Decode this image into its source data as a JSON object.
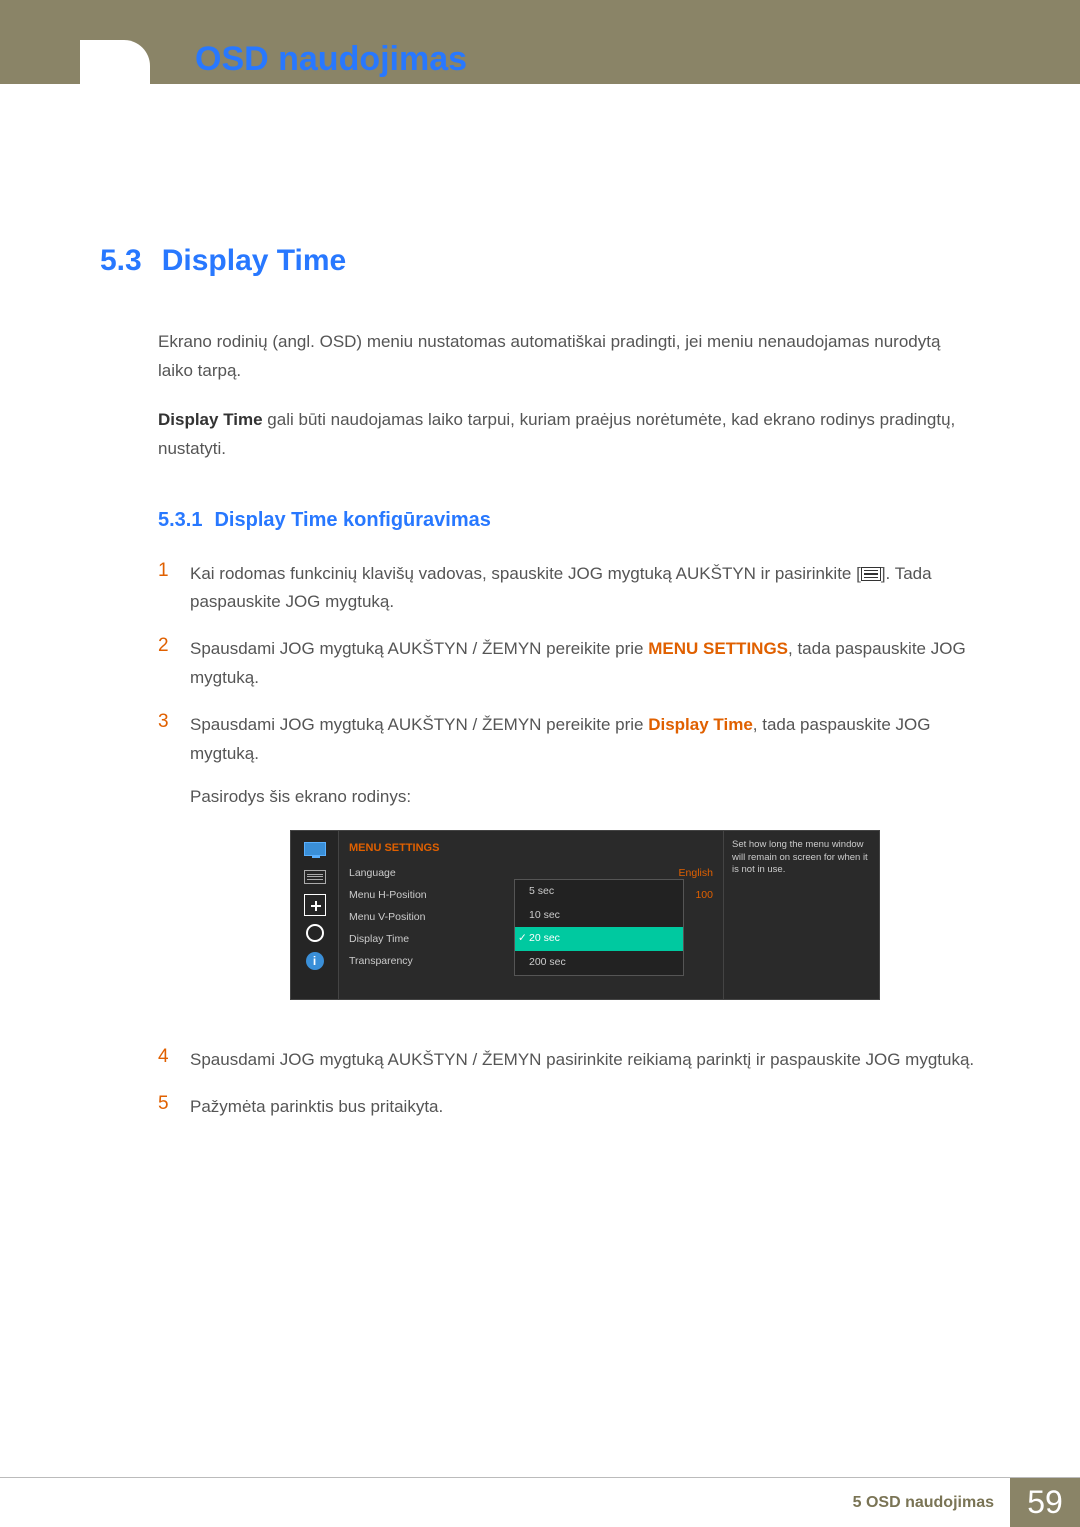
{
  "header": {
    "chapter_title": "OSD naudojimas"
  },
  "section": {
    "number": "5.3",
    "title": "Display Time",
    "para1": "Ekrano rodinių (angl. OSD) meniu nustatomas automatiškai pradingti, jei meniu nenaudojamas nurodytą laiko tarpą.",
    "para2_bold": "Display Time",
    "para2_rest": " gali būti naudojamas laiko tarpui, kuriam praėjus norėtumėte, kad ekrano rodinys pradingtų, nustatyti."
  },
  "subsection": {
    "number": "5.3.1",
    "title": "Display Time konfigūravimas"
  },
  "steps": [
    {
      "n": "1",
      "before": "Kai rodomas funkcinių klavišų vadovas, spauskite JOG mygtuką AUKŠTYN ir pasirinkite [",
      "after": "]. Tada paspauskite JOG mygtuką."
    },
    {
      "n": "2",
      "before": "Spausdami JOG mygtuką AUKŠTYN / ŽEMYN pereikite prie ",
      "orange": "MENU SETTINGS",
      "after": ", tada paspauskite JOG mygtuką."
    },
    {
      "n": "3",
      "before": "Spausdami JOG mygtuką AUKŠTYN / ŽEMYN pereikite prie ",
      "orange": "Display Time",
      "after": ", tada paspauskite JOG mygtuką.",
      "subline": "Pasirodys šis ekrano rodinys:"
    },
    {
      "n": "4",
      "before": "Spausdami JOG mygtuką AUKŠTYN / ŽEMYN pasirinkite reikiamą parinktį ir paspauskite JOG mygtuką."
    },
    {
      "n": "5",
      "before": "Pažymėta parinktis bus pritaikyta."
    }
  ],
  "osd": {
    "title": "MENU SETTINGS",
    "rows": [
      {
        "label": "Language",
        "value": "English"
      },
      {
        "label": "Menu H-Position",
        "value": "100"
      },
      {
        "label": "Menu V-Position",
        "value": ""
      },
      {
        "label": "Display Time",
        "value": ""
      },
      {
        "label": "Transparency",
        "value": ""
      }
    ],
    "options": [
      "5 sec",
      "10 sec",
      "20 sec",
      "200 sec"
    ],
    "selected": "20 sec",
    "help": "Set how long the menu window will remain on screen for when it is not in use."
  },
  "footer": {
    "label": "5 OSD naudojimas",
    "page": "59"
  }
}
